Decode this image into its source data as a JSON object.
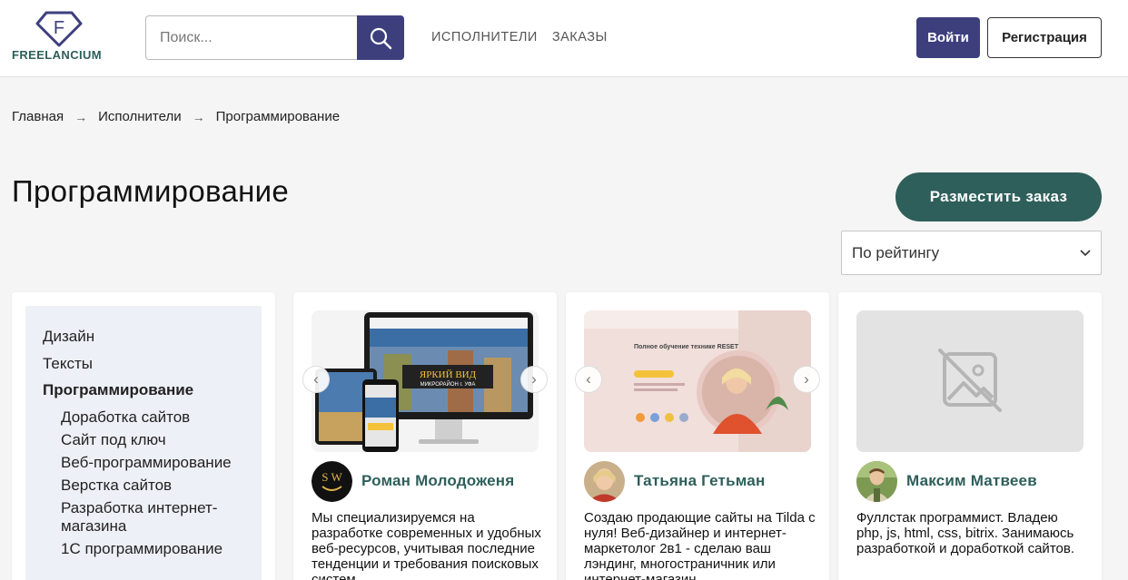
{
  "header": {
    "logo_text": "FREELANCIUM",
    "logo_letter": "F",
    "search_placeholder": "Поиск...",
    "nav": [
      "ИСПОЛНИТЕЛИ",
      "ЗАКАЗЫ"
    ],
    "login_label": "Войти",
    "register_label": "Регистрация"
  },
  "breadcrumb": [
    "Главная",
    "Исполнители",
    "Программирование"
  ],
  "page_title": "Программирование",
  "order_button": "Разместить заказ",
  "sort": {
    "selected": "По рейтингу"
  },
  "sidebar": {
    "categories": [
      "Дизайн",
      "Тексты",
      "Программирование"
    ],
    "subcategories": [
      "Доработка сайтов",
      "Сайт под ключ",
      "Веб-программирование",
      "Верстка сайтов",
      "Разработка интернет-магазина",
      "1С программирование"
    ]
  },
  "cards": [
    {
      "name": "Роман Молодоженя",
      "description": "Мы специализируемся на разработке современных и удобных веб-ресурсов, учитывая последние тенденции и требования поисковых систем.",
      "image_text": "ЯРКИЙ ВИД",
      "image_subtext": "МИКРОРАЙОН г. УФА"
    },
    {
      "name": "Татьяна Гетьман",
      "description": "Создаю продающие сайты на Tilda с нуля! Веб-дизайнер и интернет-маркетолог 2в1 - сделаю ваш лэндинг, многостраничник или интернет-магазин.",
      "image_text": "Полное обучение технике RESET"
    },
    {
      "name": "Максим Матвеев",
      "description": "Фуллстак программист. Владею php, js, html, css, bitrix. Занимаюсь разработкой и доработкой сайтов."
    }
  ],
  "colors": {
    "primary": "#3d3f7d",
    "accent": "#2e5f5a",
    "sidebar_bg": "#eef0f7"
  }
}
